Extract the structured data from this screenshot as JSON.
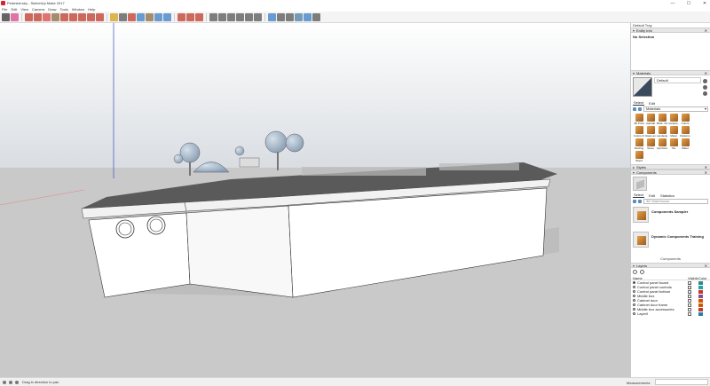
{
  "window": {
    "title": "Pedestal.skp - SketchUp Make 2017",
    "minimize": "—",
    "maximize": "☐",
    "close": "✕"
  },
  "menu": [
    "File",
    "Edit",
    "View",
    "Camera",
    "Draw",
    "Tools",
    "Window",
    "Help"
  ],
  "toolbar": {
    "buttons": [
      {
        "icon": "select-arrow-icon",
        "color": "#333333"
      },
      {
        "icon": "eraser-icon",
        "color": "#d94a8c"
      },
      {
        "icon": "pencil-icon",
        "color": "#c0392b"
      },
      {
        "icon": "arc-icon",
        "color": "#c0392b"
      },
      {
        "icon": "shape-icon",
        "color": "#d94a4a"
      },
      {
        "icon": "paint-bucket-icon",
        "color": "#8b6b3d"
      },
      {
        "icon": "move-icon",
        "color": "#c0392b"
      },
      {
        "icon": "push-pull-icon",
        "color": "#c0392b"
      },
      {
        "icon": "rotate-icon",
        "color": "#c0392b"
      },
      {
        "icon": "scale-icon",
        "color": "#c0392b"
      },
      {
        "icon": "offset-icon",
        "color": "#c0392b"
      },
      {
        "icon": "tape-measure-icon",
        "color": "#d4a017"
      },
      {
        "icon": "text-icon",
        "color": "#555555"
      },
      {
        "icon": "axes-icon",
        "color": "#c0392b"
      },
      {
        "icon": "orbit-icon",
        "color": "#3b7dc4"
      },
      {
        "icon": "pan-icon",
        "color": "#8b6b3d"
      },
      {
        "icon": "zoom-icon",
        "color": "#3b7dc4"
      },
      {
        "icon": "zoom-extents-icon",
        "color": "#3b7dc4"
      },
      {
        "icon": "warehouse-icon",
        "color": "#c0392b"
      },
      {
        "icon": "extension-icon",
        "color": "#c0392b"
      },
      {
        "icon": "ruby-icon",
        "color": "#c0392b"
      },
      {
        "icon": "iso-view-icon",
        "color": "#555555"
      },
      {
        "icon": "top-view-icon",
        "color": "#555555"
      },
      {
        "icon": "front-view-icon",
        "color": "#555555"
      },
      {
        "icon": "right-view-icon",
        "color": "#555555"
      },
      {
        "icon": "back-view-icon",
        "color": "#555555"
      },
      {
        "icon": "left-view-icon",
        "color": "#555555"
      },
      {
        "icon": "xray-icon",
        "color": "#3b7dc4"
      },
      {
        "icon": "wireframe-icon",
        "color": "#555555"
      },
      {
        "icon": "hidden-line-icon",
        "color": "#555555"
      },
      {
        "icon": "shaded-icon",
        "color": "#4a7fa5"
      },
      {
        "icon": "shaded-texture-icon",
        "color": "#3b7dc4"
      },
      {
        "icon": "monochrome-icon",
        "color": "#555555"
      }
    ]
  },
  "status": {
    "hint": "Drag in direction to pan",
    "measurements_label": "Measurements"
  },
  "tray": {
    "title": "Default Tray",
    "entity_info": {
      "header": "Entity Info",
      "selection": "No Selection"
    },
    "materials": {
      "header": "Materials",
      "current": "Default",
      "tabs": [
        "Select",
        "Edit"
      ],
      "library": "Materials",
      "items": [
        "3D Printi",
        "Asphalt",
        "Brick, Cla",
        "Carpets, T",
        "Colors",
        "",
        "Colors-Na",
        "Glass and",
        "Landscap",
        "Metal",
        "Patterns",
        "",
        "Roofing",
        "Stone",
        "Synthetic",
        "Tile",
        "Water",
        "",
        "Wood",
        "",
        "",
        "",
        "",
        ""
      ]
    },
    "styles": {
      "header": "Styles"
    },
    "components": {
      "header": "Components",
      "tabs": [
        "Select",
        "Edit",
        "Statistics"
      ],
      "search_placeholder": "3D Warehouse",
      "items": [
        "Components Sampler",
        "Dynamic Components Training"
      ],
      "footer": "Components"
    },
    "layers": {
      "header": "Layers",
      "columns": [
        "Name",
        "Visible",
        "Color"
      ],
      "rows": [
        {
          "name": "Control panel board",
          "visible": true,
          "color": "#2a8c8c",
          "active": true
        },
        {
          "name": "Control panel controls",
          "visible": true,
          "color": "#2aa0a0",
          "active": false
        },
        {
          "name": "Control panel bottom",
          "visible": true,
          "color": "#c0392b",
          "active": false
        },
        {
          "name": "Middle box",
          "visible": false,
          "color": "#8e4a8e",
          "active": false
        },
        {
          "name": "Cabinet door",
          "visible": false,
          "color": "#d35400",
          "active": false
        },
        {
          "name": "Cabinet door frame",
          "visible": false,
          "color": "#d35400",
          "active": false
        },
        {
          "name": "Middle box accessories",
          "visible": false,
          "color": "#c0392b",
          "active": false
        },
        {
          "name": "Layer0",
          "visible": false,
          "color": "#2a7fa5",
          "active": false
        }
      ]
    }
  }
}
